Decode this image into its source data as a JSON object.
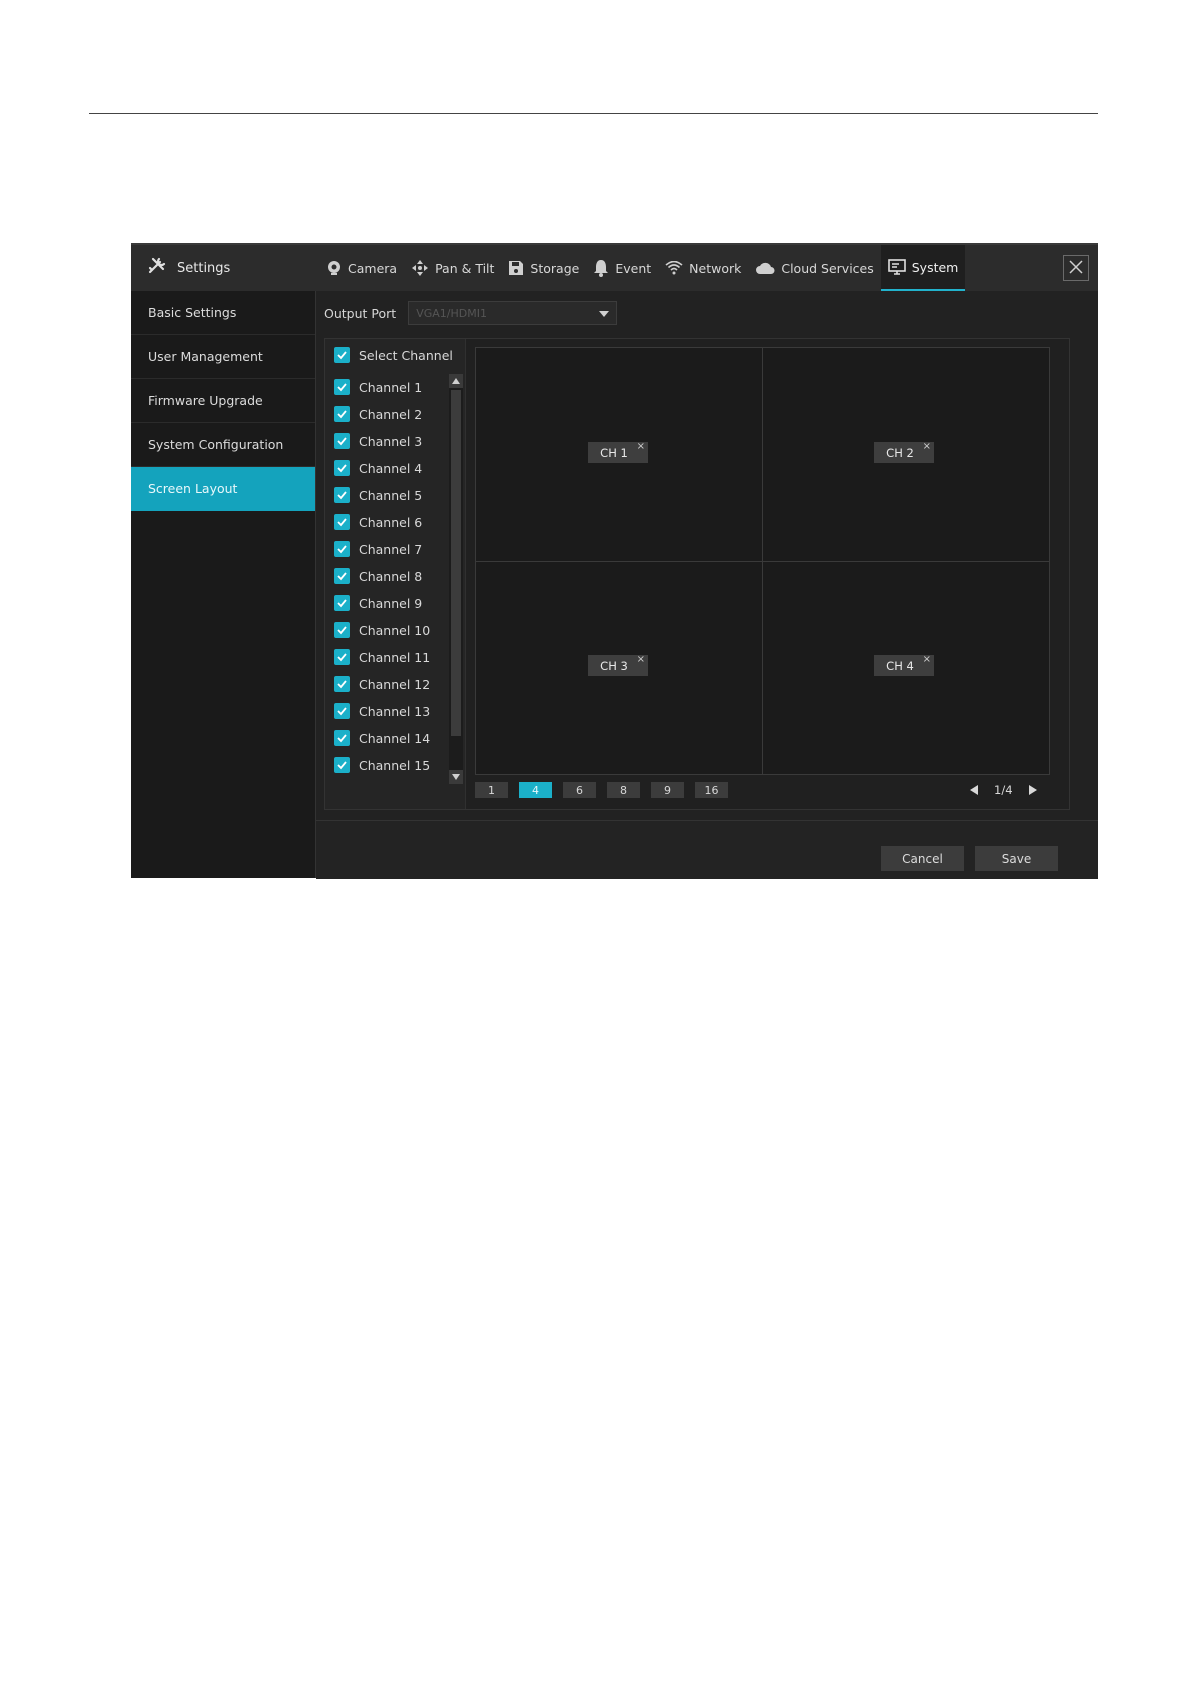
{
  "app": {
    "title": "Settings",
    "tabs": [
      {
        "label": "Camera",
        "icon": "camera-icon"
      },
      {
        "label": "Pan & Tilt",
        "icon": "pan-tilt-icon"
      },
      {
        "label": "Storage",
        "icon": "storage-icon"
      },
      {
        "label": "Event",
        "icon": "bell-icon"
      },
      {
        "label": "Network",
        "icon": "wifi-icon"
      },
      {
        "label": "Cloud Services",
        "icon": "cloud-icon"
      },
      {
        "label": "System",
        "icon": "monitor-icon",
        "active": true
      }
    ]
  },
  "sidebar": {
    "items": [
      {
        "label": "Basic Settings"
      },
      {
        "label": "User Management"
      },
      {
        "label": "Firmware Upgrade"
      },
      {
        "label": "System Configuration"
      },
      {
        "label": "Screen Layout",
        "active": true
      }
    ]
  },
  "output_port": {
    "label": "Output Port",
    "value": "VGA1/HDMI1"
  },
  "channels": {
    "select_all_label": "Select Channel",
    "items": [
      {
        "label": "Channel 1",
        "checked": true
      },
      {
        "label": "Channel 2",
        "checked": true
      },
      {
        "label": "Channel 3",
        "checked": true
      },
      {
        "label": "Channel 4",
        "checked": true
      },
      {
        "label": "Channel 5",
        "checked": true
      },
      {
        "label": "Channel 6",
        "checked": true
      },
      {
        "label": "Channel 7",
        "checked": true
      },
      {
        "label": "Channel 8",
        "checked": true
      },
      {
        "label": "Channel 9",
        "checked": true
      },
      {
        "label": "Channel 10",
        "checked": true
      },
      {
        "label": "Channel 11",
        "checked": true
      },
      {
        "label": "Channel 12",
        "checked": true
      },
      {
        "label": "Channel 13",
        "checked": true
      },
      {
        "label": "Channel 14",
        "checked": true
      },
      {
        "label": "Channel 15",
        "checked": true
      }
    ]
  },
  "grid": {
    "cells": [
      {
        "label": "CH 1",
        "remove": "×"
      },
      {
        "label": "CH 2",
        "remove": "×"
      },
      {
        "label": "CH 3",
        "remove": "×"
      },
      {
        "label": "CH 4",
        "remove": "×"
      }
    ]
  },
  "layout_options": [
    "1",
    "4",
    "6",
    "8",
    "9",
    "16"
  ],
  "layout_selected": "4",
  "pager": {
    "text": "1/4"
  },
  "footer": {
    "cancel_label": "Cancel",
    "save_label": "Save"
  },
  "colors": {
    "accent": "#1bb0c9",
    "background": "#1e1e1e"
  }
}
